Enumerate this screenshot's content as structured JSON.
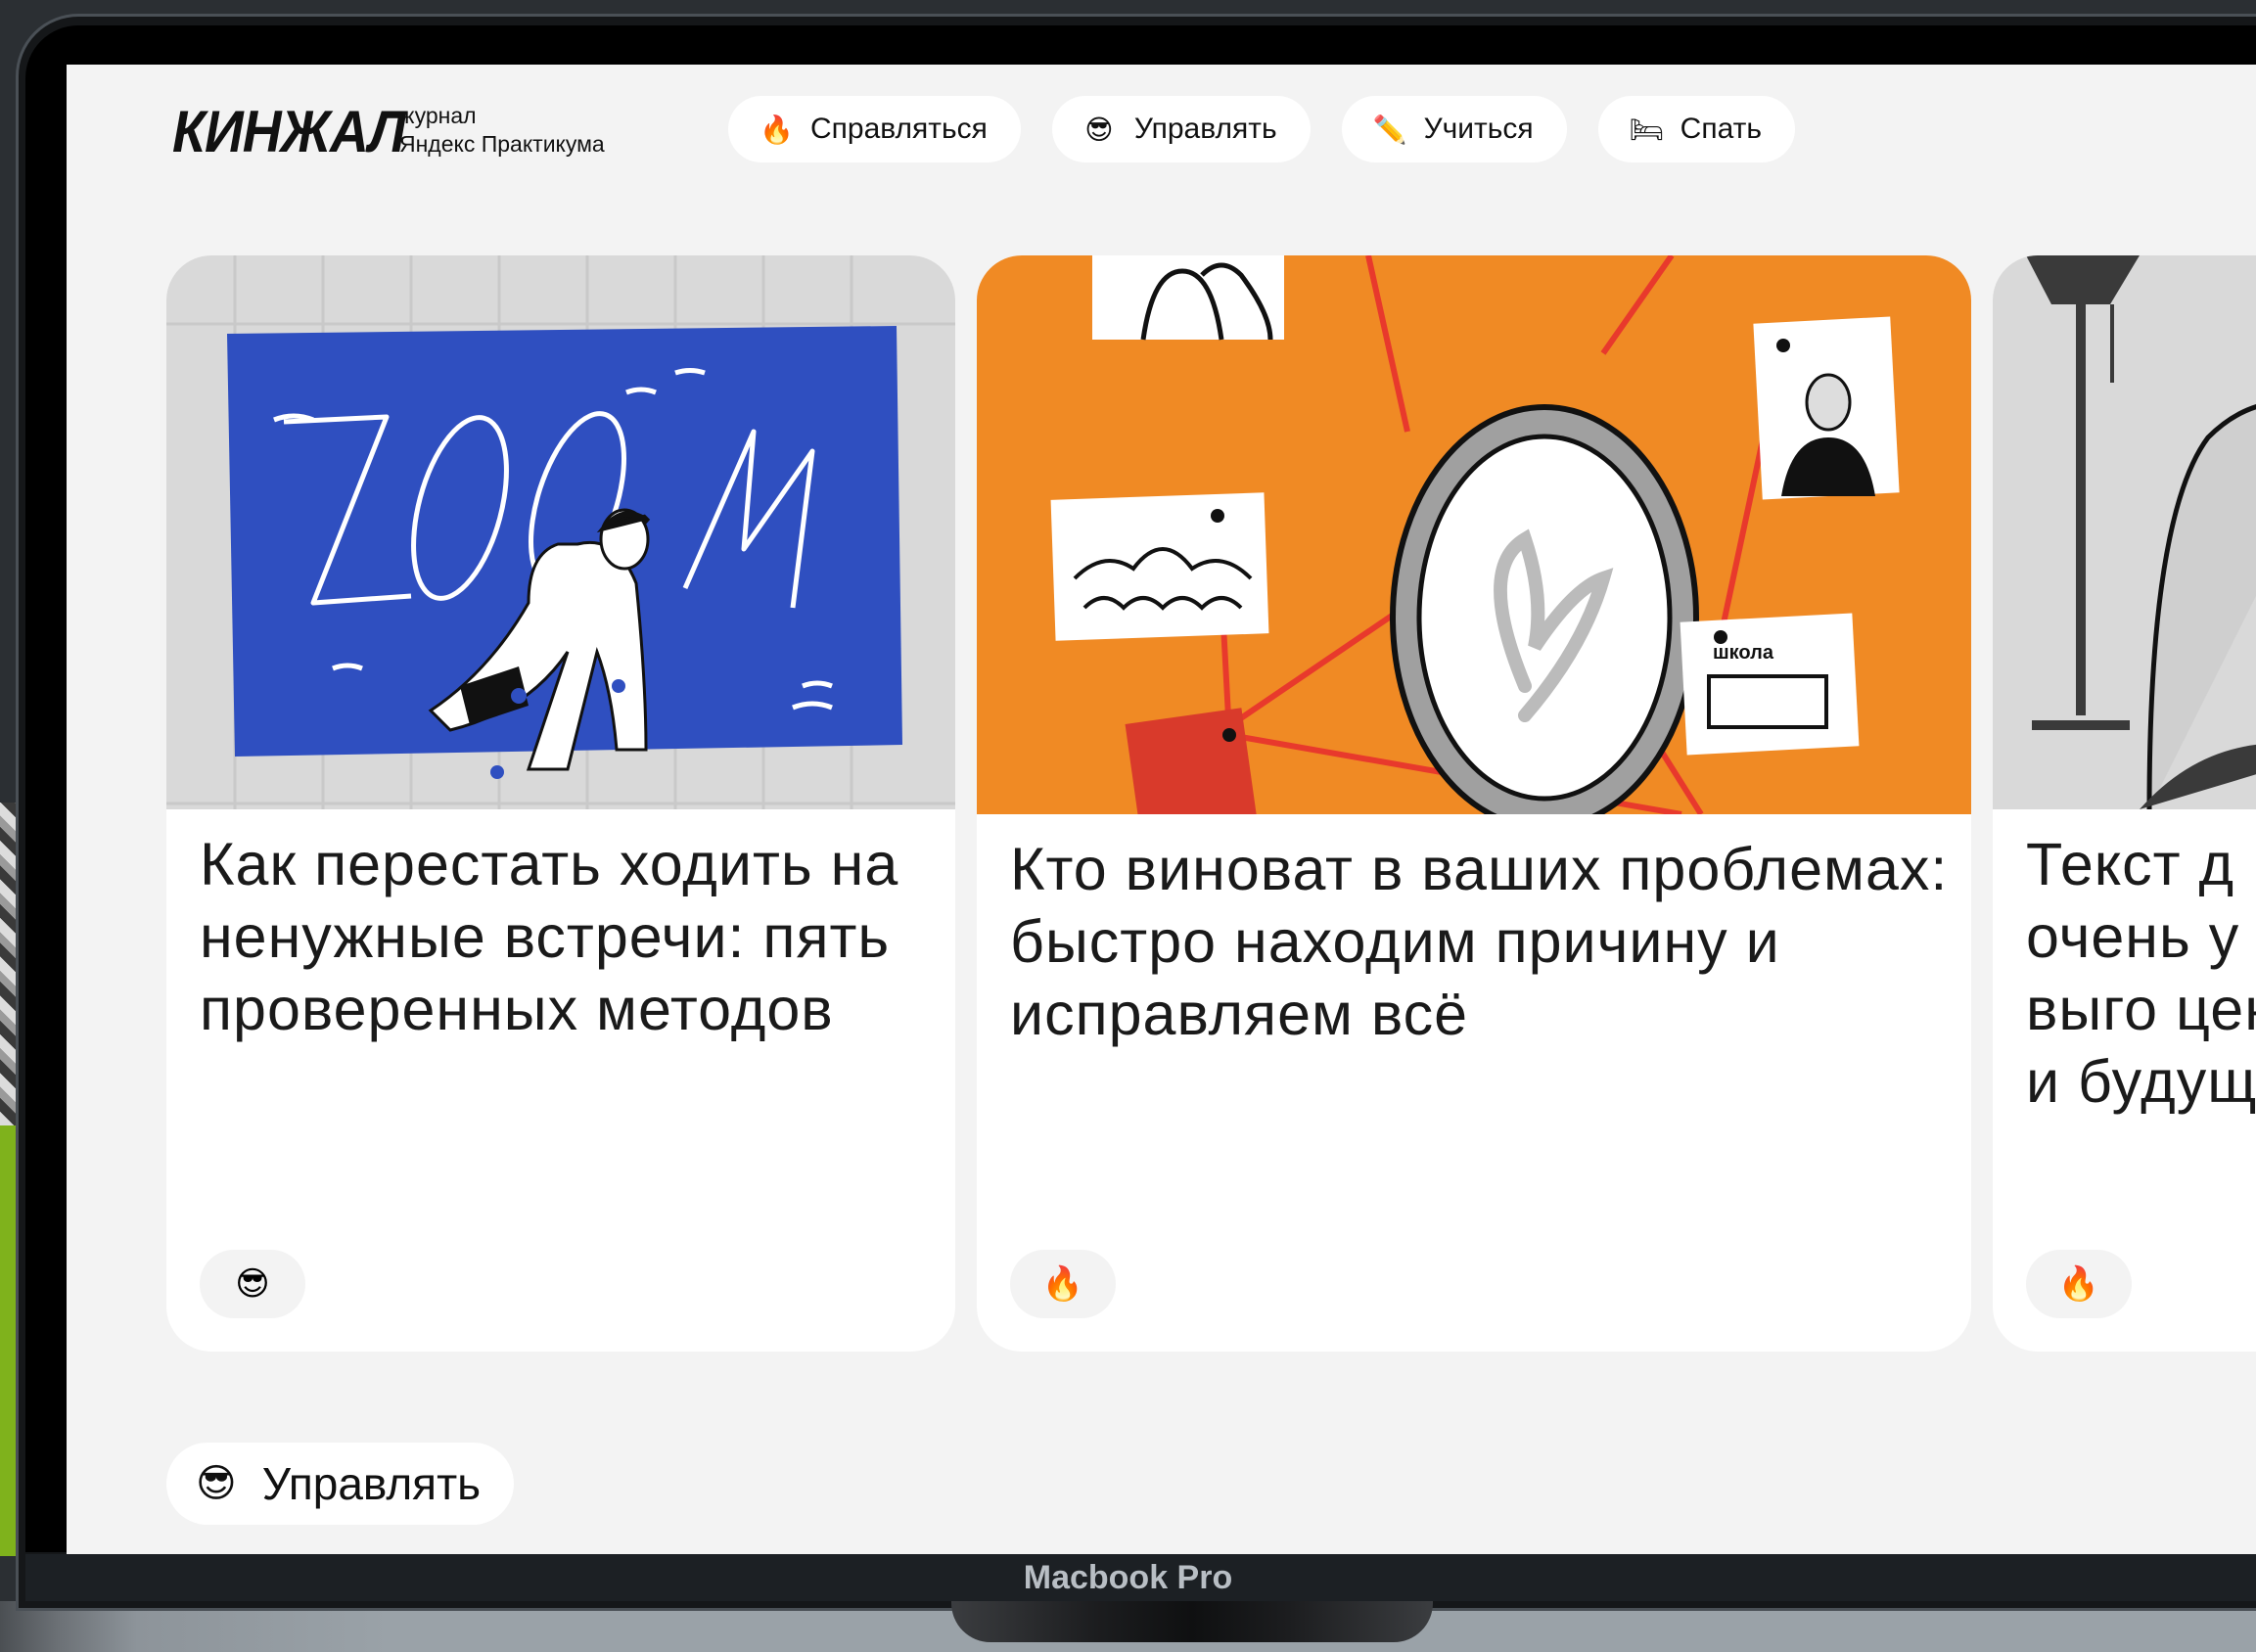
{
  "header": {
    "logo": "КИНЖАЛ",
    "tagline_line1": "журнал",
    "tagline_line2": "Яндекс Практикума"
  },
  "nav": [
    {
      "icon": "🔥",
      "icon_name": "fire-icon",
      "label": "Справляться"
    },
    {
      "icon": "😎",
      "icon_name": "sunglasses-face-icon",
      "label": "Управлять"
    },
    {
      "icon": "✏️",
      "icon_name": "pencil-icon",
      "label": "Учиться"
    },
    {
      "icon": "🛏",
      "icon_name": "bed-icon",
      "label": "Спать"
    }
  ],
  "cards": [
    {
      "title": "Как перестать ходить на ненужные встречи: пять проверенных методов",
      "tag_icon": "😎",
      "tag_icon_name": "sunglasses-face-icon",
      "image_text": "ZOOM"
    },
    {
      "title": "Кто виноват в ваших проблемах: быстро находим причину и исправляем всё",
      "tag_icon": "🔥",
      "tag_icon_name": "fire-icon",
      "image_text": "школа"
    },
    {
      "title": "Текст д очень у (о выго ценнос и будущ",
      "tag_icon": "🔥",
      "tag_icon_name": "fire-icon"
    }
  ],
  "section": {
    "icon": "😎",
    "icon_name": "sunglasses-face-icon",
    "label": "Управлять"
  },
  "device_label": "Macbook Pro",
  "colors": {
    "page_bg": "#f3f3f3",
    "card_bg": "#ffffff",
    "zoom_blue": "#2f4fc0",
    "mirror_orange": "#f08a24",
    "thread_red": "#e8392c"
  }
}
